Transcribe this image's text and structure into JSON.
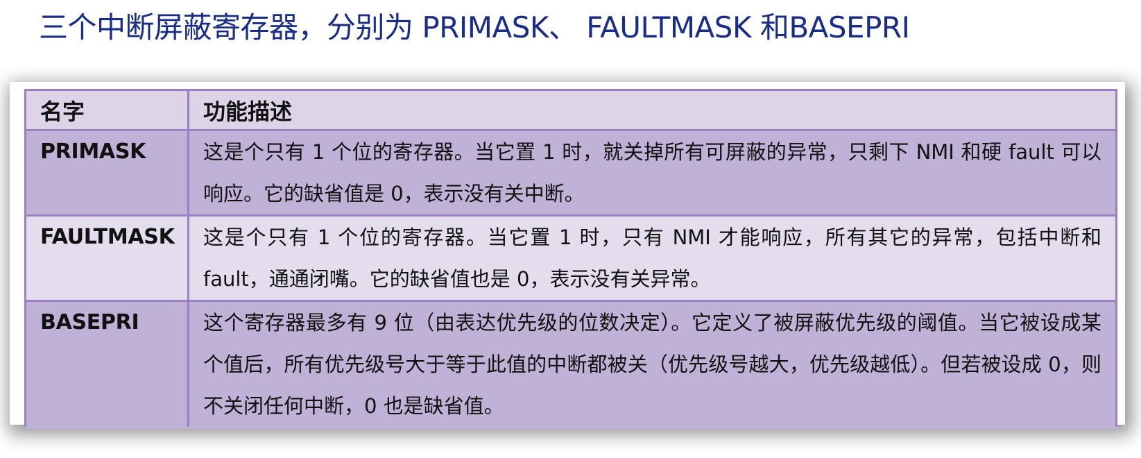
{
  "slide": {
    "title": "三个中断屏蔽寄存器，分别为 PRIMASK、 FAULTMASK 和BASEPRI"
  },
  "table": {
    "headers": {
      "name": "名字",
      "description": "功能描述"
    },
    "rows": [
      {
        "name": "PRIMASK",
        "description": "这是个只有 1 个位的寄存器。当它置 1 时，就关掉所有可屏蔽的异常，只剩下 NMI 和硬 fault 可以响应。它的缺省值是 0，表示没有关中断。"
      },
      {
        "name": "FAULTMASK",
        "description": "这是个只有 1 个位的寄存器。当它置 1 时，只有 NMI 才能响应，所有其它的异常，包括中断和 fault，通通闭嘴。它的缺省值也是 0，表示没有关异常。"
      },
      {
        "name": "BASEPRI",
        "description": "这个寄存器最多有 9 位（由表达优先级的位数决定）。它定义了被屏蔽优先级的阈值。当它被设成某个值后，所有优先级号大于等于此值的中断都被关（优先级号越大，优先级越低）。但若被设成 0，则不关闭任何中断，0 也是缺省值。"
      }
    ]
  },
  "colors": {
    "title": "#1a2d86",
    "header_bg": "#ddd4e8",
    "row_dark_bg": "#c0b1d7",
    "row_light_bg": "#e3ddee",
    "border": "#9a80c0"
  }
}
